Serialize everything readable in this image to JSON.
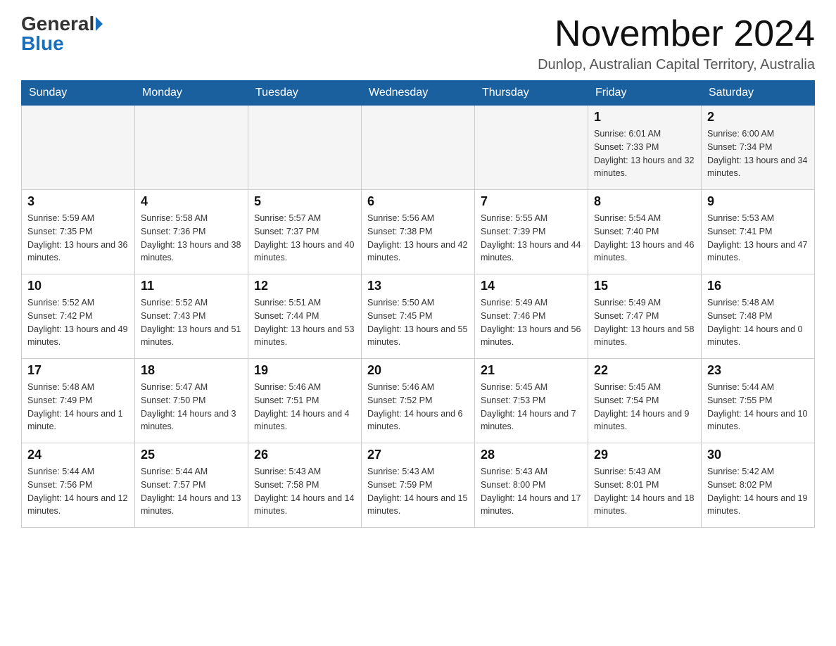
{
  "logo": {
    "general": "General",
    "blue": "Blue"
  },
  "header": {
    "month_year": "November 2024",
    "location": "Dunlop, Australian Capital Territory, Australia"
  },
  "days_of_week": [
    "Sunday",
    "Monday",
    "Tuesday",
    "Wednesday",
    "Thursday",
    "Friday",
    "Saturday"
  ],
  "weeks": [
    [
      {
        "day": "",
        "sunrise": "",
        "sunset": "",
        "daylight": ""
      },
      {
        "day": "",
        "sunrise": "",
        "sunset": "",
        "daylight": ""
      },
      {
        "day": "",
        "sunrise": "",
        "sunset": "",
        "daylight": ""
      },
      {
        "day": "",
        "sunrise": "",
        "sunset": "",
        "daylight": ""
      },
      {
        "day": "",
        "sunrise": "",
        "sunset": "",
        "daylight": ""
      },
      {
        "day": "1",
        "sunrise": "Sunrise: 6:01 AM",
        "sunset": "Sunset: 7:33 PM",
        "daylight": "Daylight: 13 hours and 32 minutes."
      },
      {
        "day": "2",
        "sunrise": "Sunrise: 6:00 AM",
        "sunset": "Sunset: 7:34 PM",
        "daylight": "Daylight: 13 hours and 34 minutes."
      }
    ],
    [
      {
        "day": "3",
        "sunrise": "Sunrise: 5:59 AM",
        "sunset": "Sunset: 7:35 PM",
        "daylight": "Daylight: 13 hours and 36 minutes."
      },
      {
        "day": "4",
        "sunrise": "Sunrise: 5:58 AM",
        "sunset": "Sunset: 7:36 PM",
        "daylight": "Daylight: 13 hours and 38 minutes."
      },
      {
        "day": "5",
        "sunrise": "Sunrise: 5:57 AM",
        "sunset": "Sunset: 7:37 PM",
        "daylight": "Daylight: 13 hours and 40 minutes."
      },
      {
        "day": "6",
        "sunrise": "Sunrise: 5:56 AM",
        "sunset": "Sunset: 7:38 PM",
        "daylight": "Daylight: 13 hours and 42 minutes."
      },
      {
        "day": "7",
        "sunrise": "Sunrise: 5:55 AM",
        "sunset": "Sunset: 7:39 PM",
        "daylight": "Daylight: 13 hours and 44 minutes."
      },
      {
        "day": "8",
        "sunrise": "Sunrise: 5:54 AM",
        "sunset": "Sunset: 7:40 PM",
        "daylight": "Daylight: 13 hours and 46 minutes."
      },
      {
        "day": "9",
        "sunrise": "Sunrise: 5:53 AM",
        "sunset": "Sunset: 7:41 PM",
        "daylight": "Daylight: 13 hours and 47 minutes."
      }
    ],
    [
      {
        "day": "10",
        "sunrise": "Sunrise: 5:52 AM",
        "sunset": "Sunset: 7:42 PM",
        "daylight": "Daylight: 13 hours and 49 minutes."
      },
      {
        "day": "11",
        "sunrise": "Sunrise: 5:52 AM",
        "sunset": "Sunset: 7:43 PM",
        "daylight": "Daylight: 13 hours and 51 minutes."
      },
      {
        "day": "12",
        "sunrise": "Sunrise: 5:51 AM",
        "sunset": "Sunset: 7:44 PM",
        "daylight": "Daylight: 13 hours and 53 minutes."
      },
      {
        "day": "13",
        "sunrise": "Sunrise: 5:50 AM",
        "sunset": "Sunset: 7:45 PM",
        "daylight": "Daylight: 13 hours and 55 minutes."
      },
      {
        "day": "14",
        "sunrise": "Sunrise: 5:49 AM",
        "sunset": "Sunset: 7:46 PM",
        "daylight": "Daylight: 13 hours and 56 minutes."
      },
      {
        "day": "15",
        "sunrise": "Sunrise: 5:49 AM",
        "sunset": "Sunset: 7:47 PM",
        "daylight": "Daylight: 13 hours and 58 minutes."
      },
      {
        "day": "16",
        "sunrise": "Sunrise: 5:48 AM",
        "sunset": "Sunset: 7:48 PM",
        "daylight": "Daylight: 14 hours and 0 minutes."
      }
    ],
    [
      {
        "day": "17",
        "sunrise": "Sunrise: 5:48 AM",
        "sunset": "Sunset: 7:49 PM",
        "daylight": "Daylight: 14 hours and 1 minute."
      },
      {
        "day": "18",
        "sunrise": "Sunrise: 5:47 AM",
        "sunset": "Sunset: 7:50 PM",
        "daylight": "Daylight: 14 hours and 3 minutes."
      },
      {
        "day": "19",
        "sunrise": "Sunrise: 5:46 AM",
        "sunset": "Sunset: 7:51 PM",
        "daylight": "Daylight: 14 hours and 4 minutes."
      },
      {
        "day": "20",
        "sunrise": "Sunrise: 5:46 AM",
        "sunset": "Sunset: 7:52 PM",
        "daylight": "Daylight: 14 hours and 6 minutes."
      },
      {
        "day": "21",
        "sunrise": "Sunrise: 5:45 AM",
        "sunset": "Sunset: 7:53 PM",
        "daylight": "Daylight: 14 hours and 7 minutes."
      },
      {
        "day": "22",
        "sunrise": "Sunrise: 5:45 AM",
        "sunset": "Sunset: 7:54 PM",
        "daylight": "Daylight: 14 hours and 9 minutes."
      },
      {
        "day": "23",
        "sunrise": "Sunrise: 5:44 AM",
        "sunset": "Sunset: 7:55 PM",
        "daylight": "Daylight: 14 hours and 10 minutes."
      }
    ],
    [
      {
        "day": "24",
        "sunrise": "Sunrise: 5:44 AM",
        "sunset": "Sunset: 7:56 PM",
        "daylight": "Daylight: 14 hours and 12 minutes."
      },
      {
        "day": "25",
        "sunrise": "Sunrise: 5:44 AM",
        "sunset": "Sunset: 7:57 PM",
        "daylight": "Daylight: 14 hours and 13 minutes."
      },
      {
        "day": "26",
        "sunrise": "Sunrise: 5:43 AM",
        "sunset": "Sunset: 7:58 PM",
        "daylight": "Daylight: 14 hours and 14 minutes."
      },
      {
        "day": "27",
        "sunrise": "Sunrise: 5:43 AM",
        "sunset": "Sunset: 7:59 PM",
        "daylight": "Daylight: 14 hours and 15 minutes."
      },
      {
        "day": "28",
        "sunrise": "Sunrise: 5:43 AM",
        "sunset": "Sunset: 8:00 PM",
        "daylight": "Daylight: 14 hours and 17 minutes."
      },
      {
        "day": "29",
        "sunrise": "Sunrise: 5:43 AM",
        "sunset": "Sunset: 8:01 PM",
        "daylight": "Daylight: 14 hours and 18 minutes."
      },
      {
        "day": "30",
        "sunrise": "Sunrise: 5:42 AM",
        "sunset": "Sunset: 8:02 PM",
        "daylight": "Daylight: 14 hours and 19 minutes."
      }
    ]
  ]
}
